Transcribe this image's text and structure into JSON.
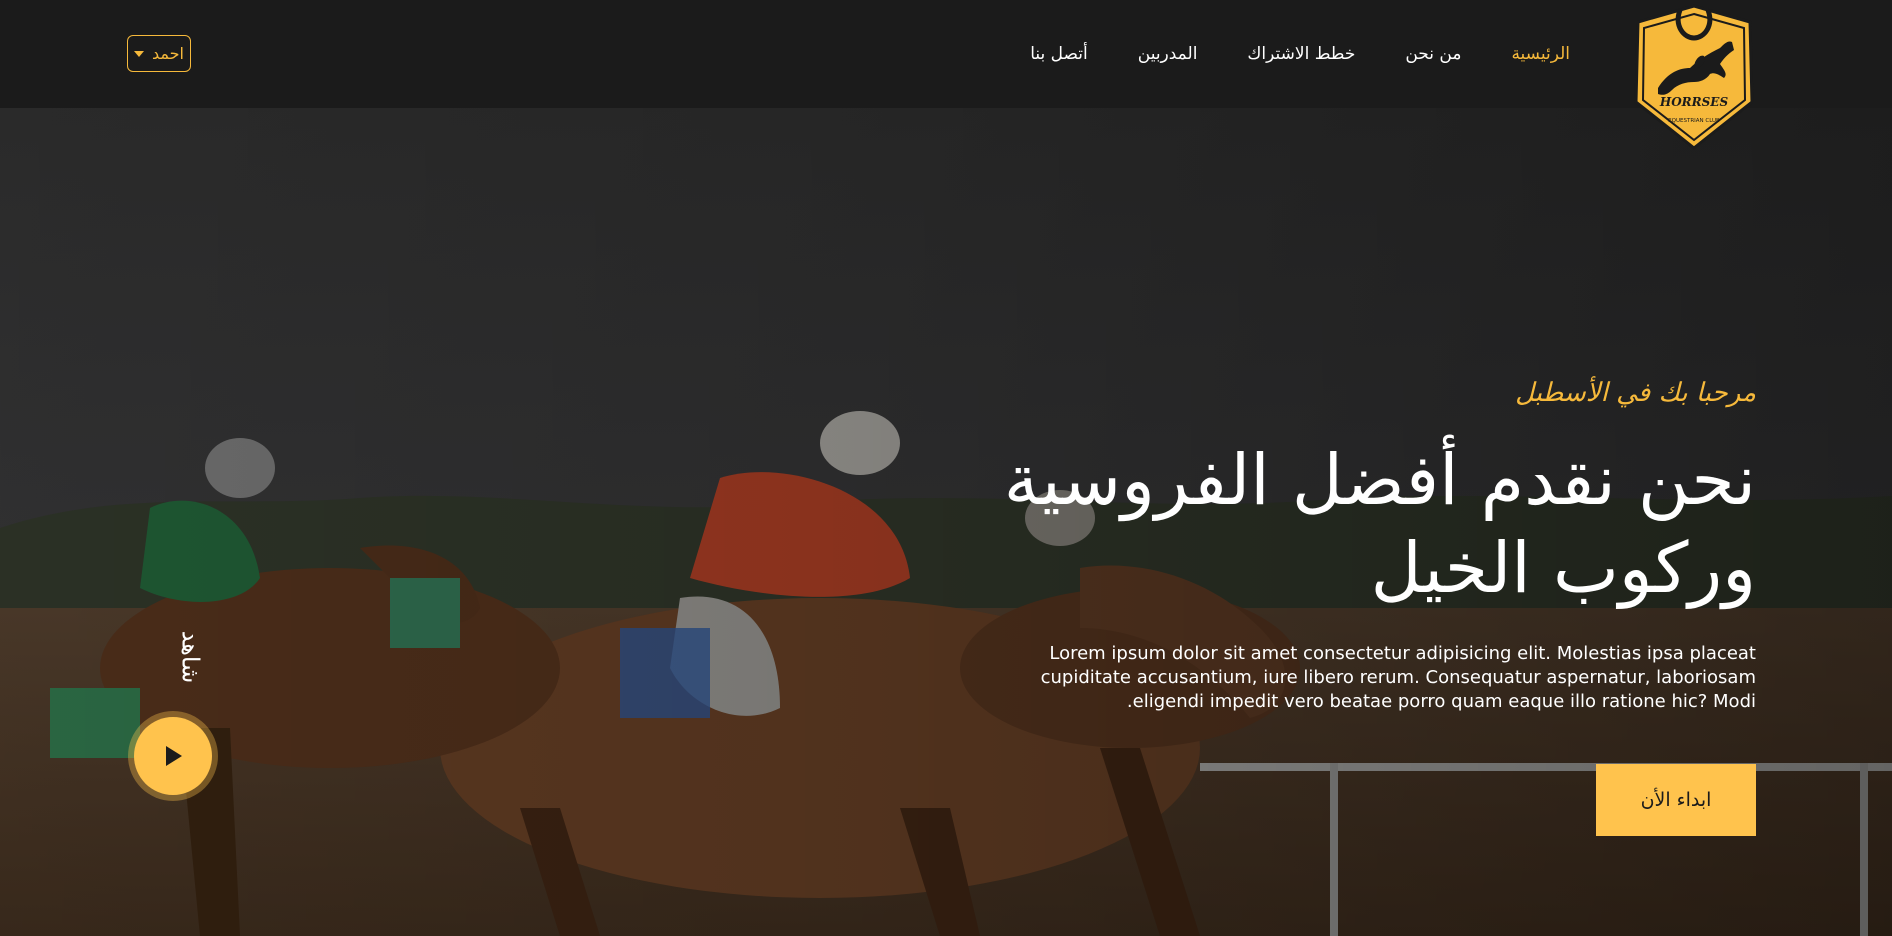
{
  "brand": {
    "logo_text": "HORRSES",
    "logo_subtext": "EQUESTRIAN CLUB",
    "accent_color": "#f6b93b",
    "button_color": "#ffc34d"
  },
  "nav": {
    "items": [
      {
        "label": "الرئيسية",
        "active": true
      },
      {
        "label": "من نحن",
        "active": false
      },
      {
        "label": "خطط الاشتراك",
        "active": false
      },
      {
        "label": "المدربين",
        "active": false
      },
      {
        "label": "أتصل بنا",
        "active": false
      }
    ]
  },
  "user_menu": {
    "label": "احمد",
    "icon": "caret-down-icon"
  },
  "hero": {
    "tagline": "مرحبا بك في الأسطبل",
    "headline_line1": "نحن نقدم أفضل الفروسية",
    "headline_line2": "وركوب الخيل",
    "description": "Lorem ipsum dolor sit amet consectetur adipisicing elit. Molestias ipsa placeat cupiditate accusantium, iure libero rerum. Consequatur aspernatur, laboriosam eligendi impedit vero beatae porro quam eaque illo ratione hic? Modi.",
    "cta_label": "ابداء الأن",
    "watch_label": "شاهد",
    "play_icon": "play-icon"
  }
}
